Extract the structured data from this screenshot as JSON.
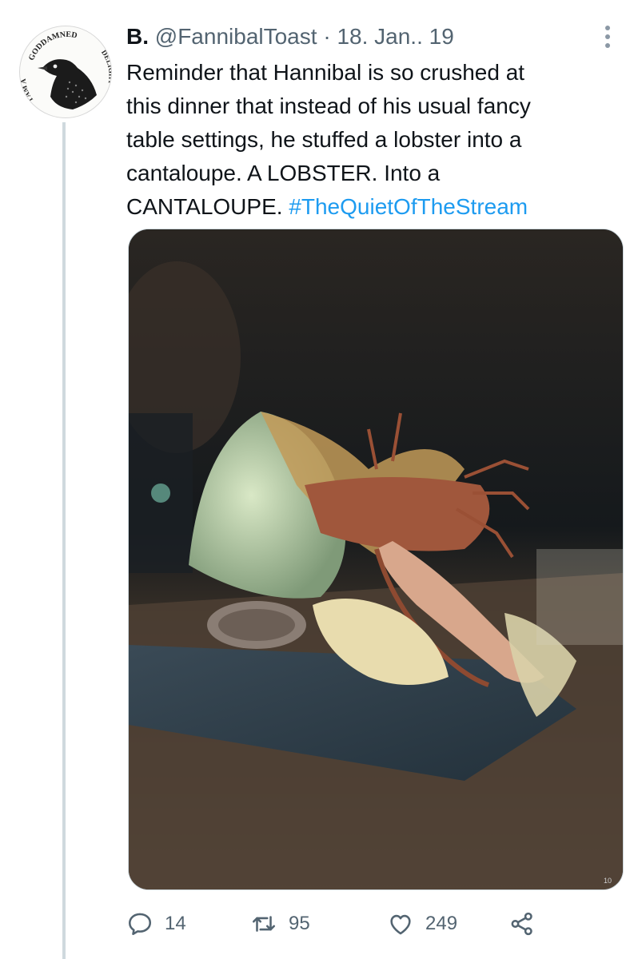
{
  "tweet": {
    "display_name": "B.",
    "handle": "@FannibalToast",
    "separator": "·",
    "date": "18. Jan.. 19",
    "text": "Reminder that Hannibal is so crushed at\nthis dinner that instead of his usual fancy\ntable settings, he stuffed a lobster into a\ncantaloupe. A LOBSTER. Into a\nCANTALOUPE. ",
    "hashtag": "#TheQuietOfTheStream",
    "avatar_text_top": "GODDAMNED",
    "avatar_text_left": "I AM A",
    "avatar_text_right": "DELIGHT"
  },
  "media": {
    "corner_marks": "10"
  },
  "actions": {
    "reply_count": "14",
    "retweet_count": "95",
    "like_count": "249"
  },
  "icons": {
    "more": "more-options-icon",
    "reply": "reply-icon",
    "retweet": "retweet-icon",
    "like": "heart-icon",
    "share": "share-icon"
  },
  "colors": {
    "hashtag": "#1d9bf0",
    "muted": "#536471",
    "thread_line": "#cfd9de"
  }
}
